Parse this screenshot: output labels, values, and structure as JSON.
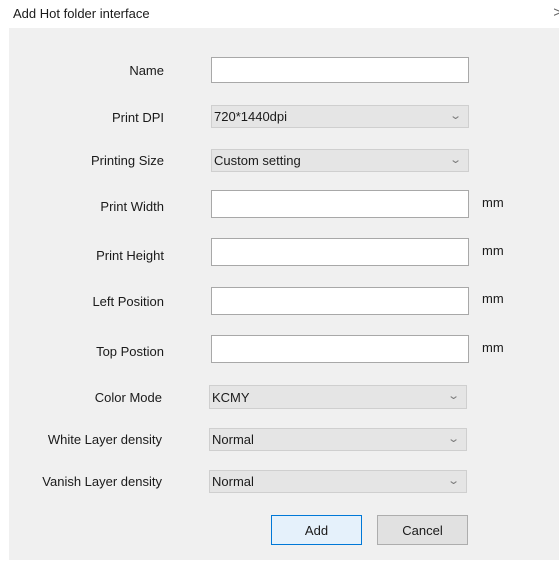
{
  "window": {
    "title": "Add Hot folder interface",
    "close_glyph": ">"
  },
  "form": {
    "name": {
      "label": "Name",
      "value": ""
    },
    "print_dpi": {
      "label": "Print DPI",
      "value": "720*1440dpi"
    },
    "printing_size": {
      "label": "Printing Size",
      "value": "Custom setting"
    },
    "print_width": {
      "label": "Print Width",
      "value": "",
      "unit": "mm"
    },
    "print_height": {
      "label": "Print Height",
      "value": "",
      "unit": "mm"
    },
    "left_position": {
      "label": "Left Position",
      "value": "",
      "unit": "mm"
    },
    "top_position": {
      "label": "Top Postion",
      "value": "",
      "unit": "mm"
    },
    "color_mode": {
      "label": "Color Mode",
      "value": "KCMY"
    },
    "white_layer_density": {
      "label": "White Layer density",
      "value": "Normal"
    },
    "vanish_layer_density": {
      "label": "Vanish Layer density",
      "value": "Normal"
    }
  },
  "buttons": {
    "add": "Add",
    "cancel": "Cancel"
  }
}
